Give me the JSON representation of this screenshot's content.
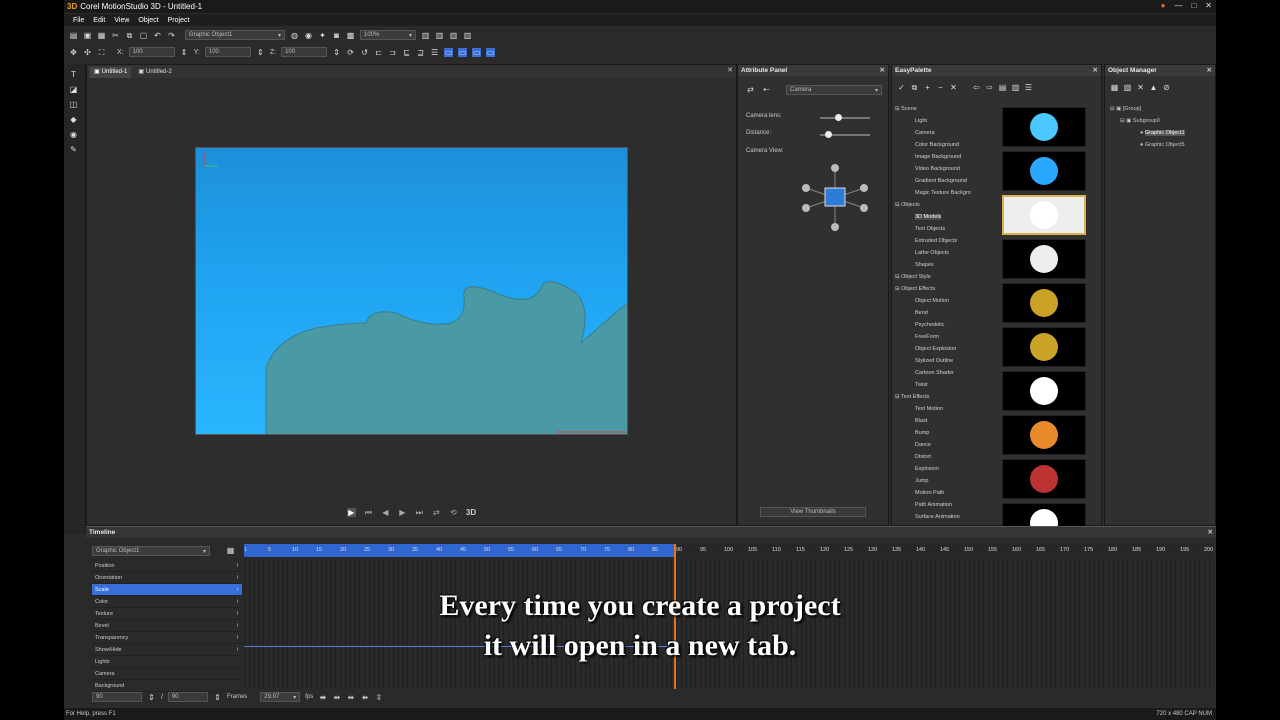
{
  "window": {
    "logo": "3D",
    "title": "Corel MotionStudio 3D - Untitled-1",
    "buttons": [
      "●",
      "—",
      "□",
      "✕"
    ]
  },
  "menu": [
    "File",
    "Edit",
    "View",
    "Object",
    "Project"
  ],
  "toolbar1": {
    "object_select": "Graphic Object1",
    "zoom": "100%"
  },
  "toolbar2": {
    "x_label": "X:",
    "x_value": "100",
    "y_label": "Y:",
    "y_value": "100",
    "z_label": "Z:",
    "z_value": "100"
  },
  "doc": {
    "tabs": [
      "Untitled-1",
      "Untitled-2"
    ],
    "play_3d": "3D"
  },
  "attribute_panel": {
    "title": "Attribute Panel",
    "dropdown": "Camera",
    "lens_label": "Camera lens:",
    "distance_label": "Distance:",
    "view_label": "Camera View:",
    "view_thumbnails": "View Thumbnails",
    "lens_level": 0.3,
    "distance_level": 0.1
  },
  "easy_palette": {
    "title": "EasyPalette",
    "tree": [
      {
        "label": "Scene",
        "type": "cat"
      },
      {
        "label": "Light",
        "type": "item"
      },
      {
        "label": "Camera",
        "type": "item"
      },
      {
        "label": "Color Background",
        "type": "item"
      },
      {
        "label": "Image Background",
        "type": "item"
      },
      {
        "label": "Video Background",
        "type": "item"
      },
      {
        "label": "Gradient Background",
        "type": "item"
      },
      {
        "label": "Magic Texture Backgro",
        "type": "item"
      },
      {
        "label": "Objects",
        "type": "cat"
      },
      {
        "label": "3D Models",
        "type": "item sel2"
      },
      {
        "label": "Text Objects",
        "type": "item"
      },
      {
        "label": "Extruded Objects",
        "type": "item"
      },
      {
        "label": "Lathe Objects",
        "type": "item"
      },
      {
        "label": "Shapes",
        "type": "item"
      },
      {
        "label": "Object Style",
        "type": "cat"
      },
      {
        "label": "Object Effects",
        "type": "cat"
      },
      {
        "label": "Object Motion",
        "type": "item"
      },
      {
        "label": "Bend",
        "type": "item"
      },
      {
        "label": "Psychedelic",
        "type": "item"
      },
      {
        "label": "FreeForm",
        "type": "item"
      },
      {
        "label": "Object Explosion",
        "type": "item"
      },
      {
        "label": "Stylized Outline",
        "type": "item"
      },
      {
        "label": "Cartoon Shader",
        "type": "item"
      },
      {
        "label": "Twist",
        "type": "item"
      },
      {
        "label": "Text Effects",
        "type": "cat"
      },
      {
        "label": "Text Motion",
        "type": "item"
      },
      {
        "label": "Blast",
        "type": "item"
      },
      {
        "label": "Bump",
        "type": "item"
      },
      {
        "label": "Dance",
        "type": "item"
      },
      {
        "label": "Distort",
        "type": "item"
      },
      {
        "label": "Explosion",
        "type": "item"
      },
      {
        "label": "Jump",
        "type": "item"
      },
      {
        "label": "Motion Path",
        "type": "item"
      },
      {
        "label": "Path Animation",
        "type": "item"
      },
      {
        "label": "Surface Animation",
        "type": "item"
      }
    ],
    "thumb_names": [
      "plane-model",
      "car-model",
      "cake-model",
      "baseball-model",
      "motion-text-model",
      "on-screen-model",
      "tricycle-model",
      "basketball-model",
      "ball-model",
      "soccer-model"
    ]
  },
  "object_manager": {
    "title": "Object Manager",
    "nodes": [
      "[Group]",
      "Subgroup0",
      "Graphic Object1",
      "Graphic Object5"
    ]
  },
  "timeline": {
    "title": "Timeline",
    "object_select": "Graphic Object1",
    "tracks": [
      "Position",
      "Orientation",
      "Scale",
      "Color",
      "Texture",
      "Bevel",
      "Transparency",
      "Show/Hide",
      "Lights",
      "Camera",
      "Background"
    ],
    "ticks": [
      "1",
      "5",
      "10",
      "15",
      "20",
      "25",
      "30",
      "35",
      "40",
      "45",
      "50",
      "55",
      "60",
      "65",
      "70",
      "75",
      "80",
      "85",
      "90",
      "95",
      "100",
      "105",
      "110",
      "115",
      "120",
      "125",
      "130",
      "135",
      "140",
      "145",
      "150",
      "155",
      "160",
      "165",
      "170",
      "175",
      "180",
      "185",
      "190",
      "195",
      "200"
    ],
    "current_frame": "90",
    "total_frames": "90",
    "frames_label": "Frames",
    "fps_value": "29.97",
    "fps_label": "fps"
  },
  "caption": {
    "line1": "Every time you create a project",
    "line2": "it will open in a new tab."
  },
  "status": {
    "left": "For Help, press F1",
    "right": "720 x 480   CAP  NUM"
  }
}
